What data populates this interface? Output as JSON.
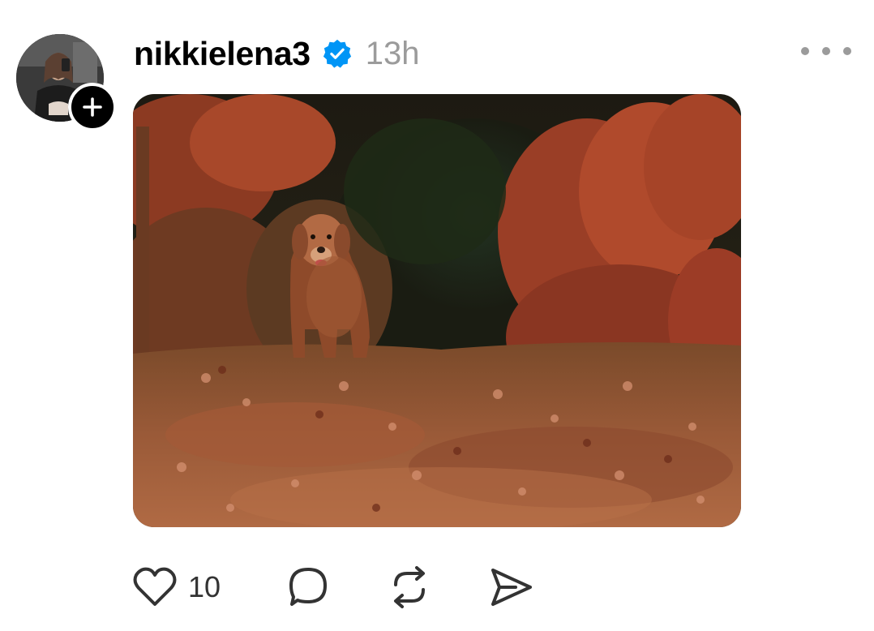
{
  "post": {
    "username": "nikkielena3",
    "timestamp": "13h",
    "verified": true,
    "media": {
      "kind": "gif",
      "subject": "golden-retriever-in-autumn-leaves"
    },
    "actions": {
      "like_count": "10"
    }
  },
  "icons": {
    "avatar": "avatar-image",
    "follow": "plus-icon",
    "verified": "verified-badge-icon",
    "more": "more-dots-icon",
    "like": "heart-icon",
    "comment": "comment-bubble-icon",
    "repost": "repost-icon",
    "share": "send-icon"
  },
  "colors": {
    "verified_blue": "#0095f6",
    "timestamp_gray": "#9b9b9b",
    "text": "#000000",
    "icon": "#333333"
  }
}
